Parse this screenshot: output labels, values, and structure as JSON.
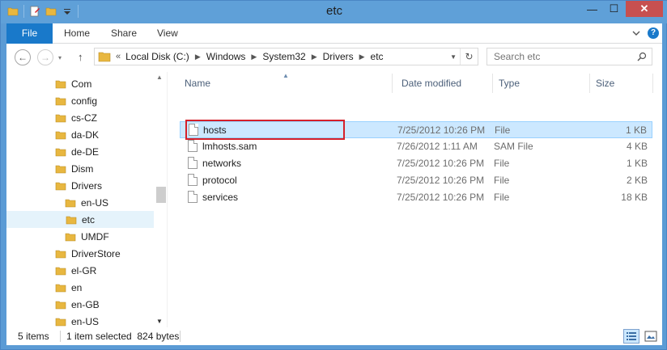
{
  "window": {
    "title": "etc",
    "minimize_label": "—",
    "maximize_label": "☐",
    "close_label": "✕"
  },
  "ribbon": {
    "tabs": [
      "File",
      "Home",
      "Share",
      "View"
    ],
    "help_label": "?"
  },
  "navigation": {
    "back_label": "←",
    "forward_label": "→",
    "up_label": "↑",
    "recent_label": "▾",
    "breadcrumb_lead": "«",
    "breadcrumb": [
      "Local Disk (C:)",
      "Windows",
      "System32",
      "Drivers",
      "etc"
    ],
    "refresh_label": "↻"
  },
  "search": {
    "placeholder": "Search etc"
  },
  "tree": {
    "items": [
      {
        "label": "Com",
        "indent": 0,
        "selected": false
      },
      {
        "label": "config",
        "indent": 0,
        "selected": false
      },
      {
        "label": "cs-CZ",
        "indent": 0,
        "selected": false
      },
      {
        "label": "da-DK",
        "indent": 0,
        "selected": false
      },
      {
        "label": "de-DE",
        "indent": 0,
        "selected": false
      },
      {
        "label": "Dism",
        "indent": 0,
        "selected": false
      },
      {
        "label": "Drivers",
        "indent": 0,
        "selected": false
      },
      {
        "label": "en-US",
        "indent": 1,
        "selected": false
      },
      {
        "label": "etc",
        "indent": 1,
        "selected": true
      },
      {
        "label": "UMDF",
        "indent": 1,
        "selected": false
      },
      {
        "label": "DriverStore",
        "indent": 0,
        "selected": false
      },
      {
        "label": "el-GR",
        "indent": 0,
        "selected": false
      },
      {
        "label": "en",
        "indent": 0,
        "selected": false
      },
      {
        "label": "en-GB",
        "indent": 0,
        "selected": false
      },
      {
        "label": "en-US",
        "indent": 0,
        "selected": false
      }
    ]
  },
  "filelist": {
    "columns": {
      "name": "Name",
      "date": "Date modified",
      "type": "Type",
      "size": "Size"
    },
    "rows": [
      {
        "name": "hosts",
        "date": "7/25/2012 10:26 PM",
        "type": "File",
        "size": "1 KB",
        "selected": true
      },
      {
        "name": "lmhosts.sam",
        "date": "7/26/2012 1:11 AM",
        "type": "SAM File",
        "size": "4 KB",
        "selected": false
      },
      {
        "name": "networks",
        "date": "7/25/2012 10:26 PM",
        "type": "File",
        "size": "1 KB",
        "selected": false
      },
      {
        "name": "protocol",
        "date": "7/25/2012 10:26 PM",
        "type": "File",
        "size": "2 KB",
        "selected": false
      },
      {
        "name": "services",
        "date": "7/25/2012 10:26 PM",
        "type": "File",
        "size": "18 KB",
        "selected": false
      }
    ]
  },
  "status": {
    "item_count": "5 items",
    "selection": "1 item selected  824 bytes"
  },
  "colors": {
    "titlebar": "#5fa0d8",
    "file_tab": "#1979ca",
    "folder_yellow": "#e8b740",
    "selection": "#cce8ff",
    "highlight": "#d6202a"
  }
}
